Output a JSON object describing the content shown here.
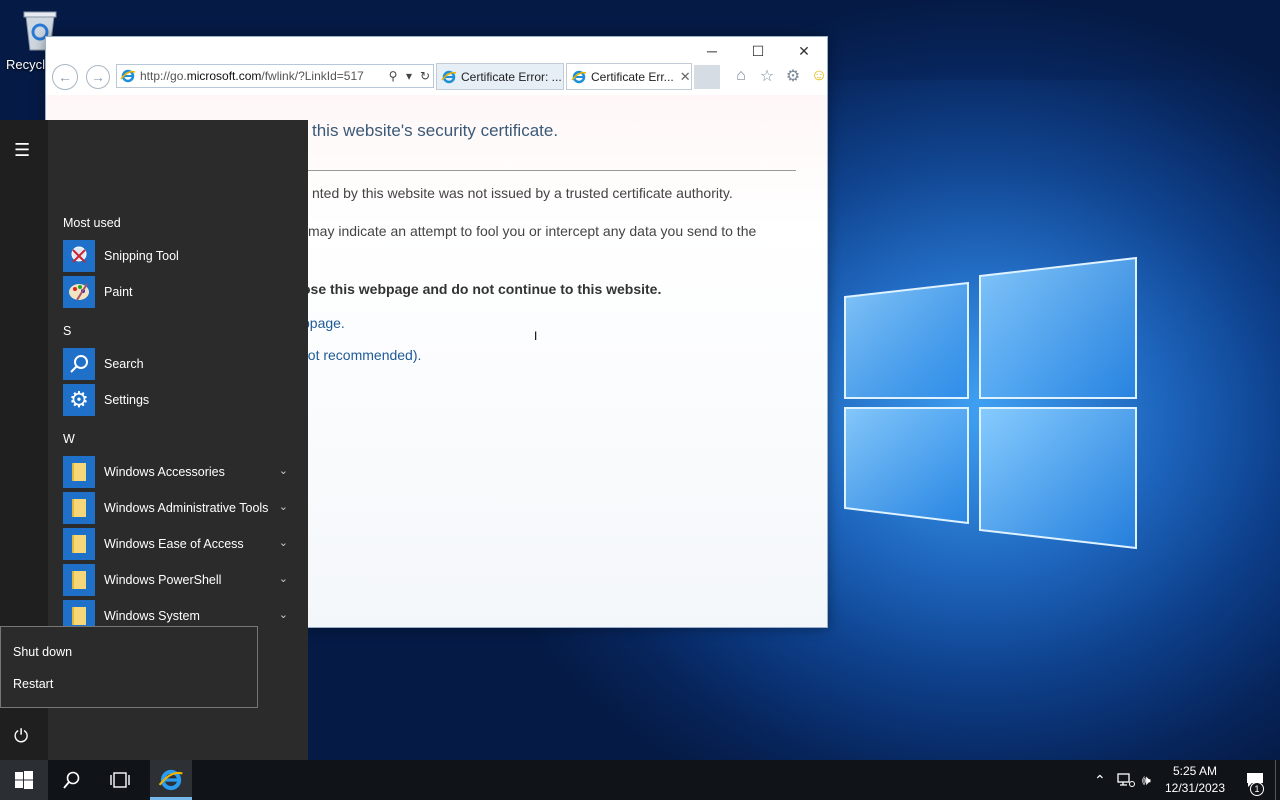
{
  "desktop": {
    "recycle_bin_label": "Recycle"
  },
  "ie": {
    "url_prefix": "http://go.",
    "url_domain": "microsoft.com",
    "url_suffix": "/fwlink/?LinkId=517",
    "tabs": [
      {
        "label": "Certificate Error: ..."
      },
      {
        "label": "Certificate Err..."
      }
    ],
    "content": {
      "title": "this website's security certificate.",
      "p1": "nted by this website was not issued by a trusted certificate authority.",
      "p2": "may indicate an attempt to fool you or intercept any data you send to the",
      "p3": "ose this webpage and do not continue to this website.",
      "link1": "bpage.",
      "link2": "not recommended)."
    }
  },
  "start_menu": {
    "most_used_header": "Most used",
    "most_used": [
      {
        "label": "Snipping Tool",
        "icon": "snipping-tool-icon"
      },
      {
        "label": "Paint",
        "icon": "paint-icon"
      }
    ],
    "section_s": "S",
    "s_apps": [
      {
        "label": "Search",
        "icon": "search-icon"
      },
      {
        "label": "Settings",
        "icon": "gear-icon"
      }
    ],
    "section_w": "W",
    "w_apps": [
      {
        "label": "Windows Accessories"
      },
      {
        "label": "Windows Administrative Tools"
      },
      {
        "label": "Windows Ease of Access"
      },
      {
        "label": "Windows PowerShell"
      },
      {
        "label": "Windows System"
      }
    ],
    "power_menu": {
      "shutdown": "Shut down",
      "restart": "Restart"
    }
  },
  "taskbar": {
    "time": "5:25 AM",
    "date": "12/31/2023",
    "notification_count": "1"
  },
  "colors": {
    "accent": "#1e70c8",
    "start_bg": "#2b2b2b",
    "taskbar_bg": "#101418",
    "link": "#1f5a96"
  }
}
